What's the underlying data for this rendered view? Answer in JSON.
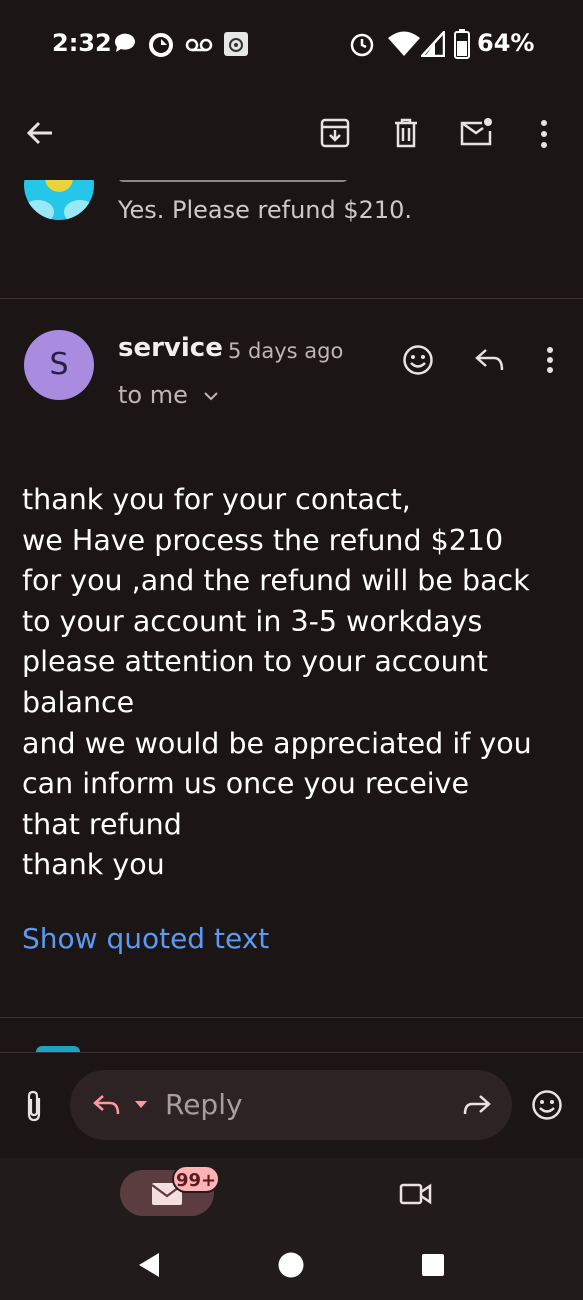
{
  "status_bar": {
    "time": "2:32",
    "battery": "64%",
    "icons": [
      "chat-icon",
      "sync-icon",
      "voicemail-icon",
      "photo-icon",
      "alarm-icon",
      "wifi-icon",
      "signal-icon",
      "battery-icon"
    ]
  },
  "app_bar": {
    "icons": [
      "back-arrow-icon",
      "archive-icon",
      "delete-icon",
      "mark-unread-icon",
      "more-vert-icon"
    ]
  },
  "previous_message": {
    "snippet": "Yes. Please refund $210."
  },
  "message": {
    "avatar_letter": "S",
    "sender": "service",
    "time": "5 days ago",
    "recipient": "to me",
    "body_lines": [
      "thank you for your contact,",
      "we Have process the refund $210",
      "for you ,and the refund will be back",
      "to your account in 3-5 workdays",
      "please attention to your account",
      "balance",
      "and we would be appreciated if you",
      "can inform us once you receive",
      "that refund",
      "thank you"
    ],
    "show_quoted": "Show quoted text"
  },
  "reply_bar": {
    "placeholder": "Reply"
  },
  "bottom_nav": {
    "mail_badge": "99+"
  },
  "colors": {
    "background": "#1b1516",
    "link": "#5b9af0",
    "avatar": "#a98be0",
    "badge": "#ffb3b4"
  }
}
